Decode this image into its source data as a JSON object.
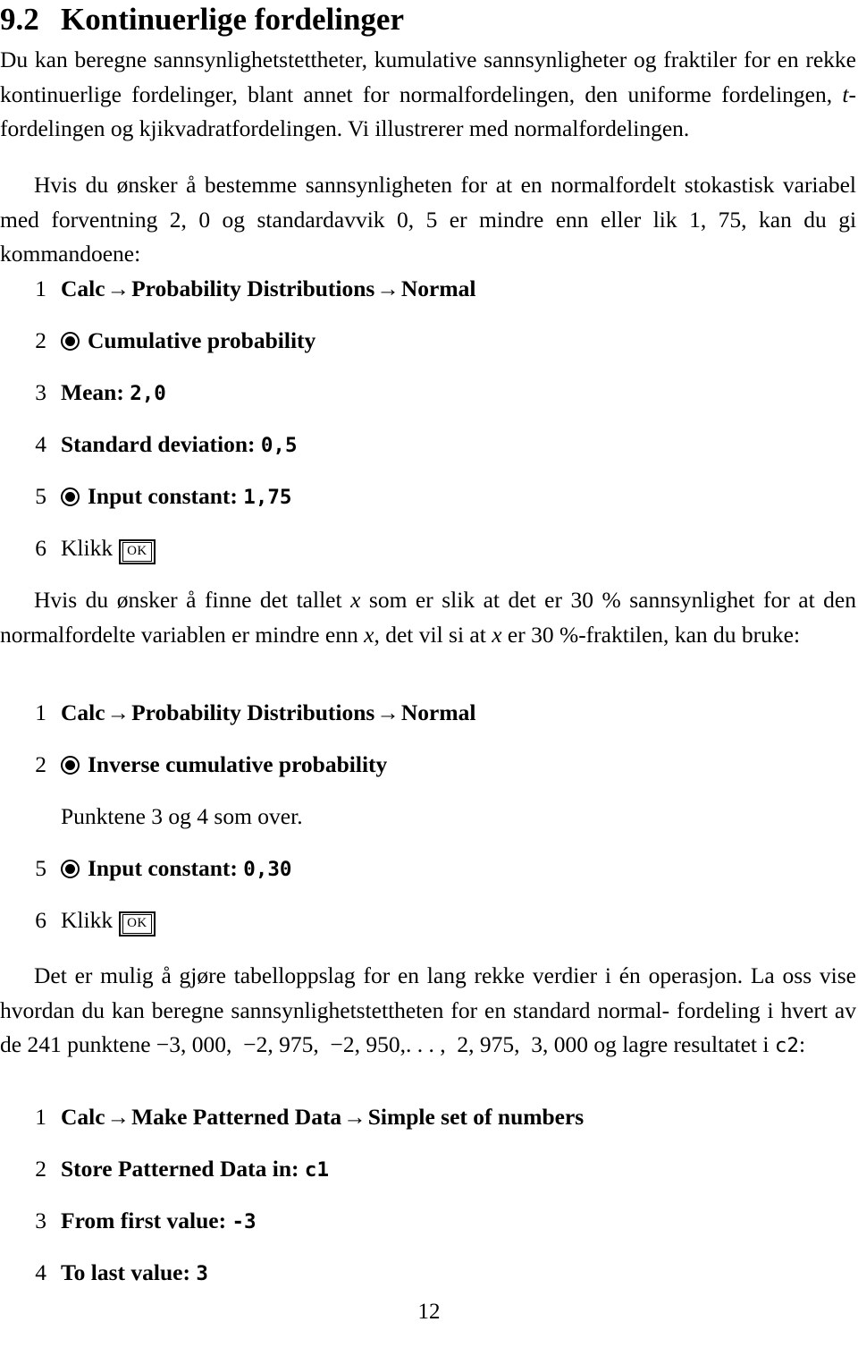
{
  "heading": {
    "number": "9.2",
    "title": "Kontinuerlige fordelinger"
  },
  "paragraph1": {
    "line_a": "Du kan beregne sannsynlighetstettheter, kumulative sannsynligheter og fraktiler",
    "line_b": "for en rekke kontinuerlige fordelinger, blant annet for normalfordelingen, den",
    "line_c_pre": "uniforme fordelingen, ",
    "line_c_math": "t",
    "line_c_post": "-fordelingen og kjikvadratfordelingen. Vi illustrerer med",
    "line_d": "normalfordelingen."
  },
  "paragraph2": {
    "line_a": "Hvis du ønsker å bestemme sannsynligheten for at en normalfordelt stokastisk",
    "line_b_pre": "variabel med forventning ",
    "line_b_val1": "2, 0",
    "line_b_mid": " og standardavvik ",
    "line_b_val2": "0, 5",
    "line_b_post": " er mindre enn eller lik ",
    "line_b_val3": "1, 75",
    "line_b_end": ",",
    "line_c": "kan du gi kommandoene:"
  },
  "list1": [
    {
      "num": "1",
      "type": "menu",
      "parts": [
        "Calc",
        "Probability Distributions",
        "Normal"
      ],
      "arrow": "→"
    },
    {
      "num": "2",
      "type": "radio",
      "label": "Cumulative probability",
      "value": ""
    },
    {
      "num": "3",
      "type": "field",
      "label": "Mean:",
      "value": "2,0"
    },
    {
      "num": "4",
      "type": "field",
      "label": "Standard deviation:",
      "value": "0,5"
    },
    {
      "num": "5",
      "type": "radio",
      "label": "Input constant:",
      "value": "1,75"
    },
    {
      "num": "6",
      "type": "click",
      "label": "Klikk",
      "button": "OK"
    }
  ],
  "paragraph3": {
    "line_a_pre": "Hvis du ønsker å finne det tallet ",
    "line_a_math": "x",
    "line_a_post": " som er slik at det er 30 % sannsynlighet for",
    "line_b_pre": "at den normalfordelte variablen er mindre enn ",
    "line_b_math1": "x",
    "line_b_mid": ", det vil si at ",
    "line_b_math2": "x",
    "line_b_post": " er 30 %-fraktilen,",
    "line_c": "kan du bruke:"
  },
  "list2": [
    {
      "num": "1",
      "type": "menu",
      "parts": [
        "Calc",
        "Probability Distributions",
        "Normal"
      ],
      "arrow": "→"
    },
    {
      "num": "2",
      "type": "radio",
      "label": "Inverse cumulative probability",
      "value": ""
    },
    {
      "num": "",
      "type": "note",
      "label": "Punktene 3 og 4 som over."
    },
    {
      "num": "5",
      "type": "radio",
      "label": "Input constant:",
      "value": "0,30"
    },
    {
      "num": "6",
      "type": "click",
      "label": "Klikk",
      "button": "OK"
    }
  ],
  "paragraph4": {
    "line_a": "Det er mulig å gjøre tabelloppslag for en lang rekke verdier i én operasjon. La",
    "line_b": "oss vise hvordan du kan beregne sannsynlighetstettheten for en standard normal-",
    "line_c_pre": "fordeling i hvert av de 241 punktene ",
    "line_c_v1": "−3, 000,",
    "line_c_v2": "−2, 975,",
    "line_c_v3": "−2, 950,",
    "line_c_dots": ". . . ,",
    "line_c_v4": "2, 975,",
    "line_c_v5": "3, 000",
    "line_d_pre": "og lagre resultatet i ",
    "line_d_mono": "c2",
    "line_d_post": ":"
  },
  "list3": [
    {
      "num": "1",
      "type": "menu",
      "parts": [
        "Calc",
        "Make Patterned Data",
        "Simple set of numbers"
      ],
      "arrow": "→"
    },
    {
      "num": "2",
      "type": "field",
      "label": "Store Patterned Data in:",
      "value": "c1"
    },
    {
      "num": "3",
      "type": "field",
      "label": "From first value:",
      "value": "-3"
    },
    {
      "num": "4",
      "type": "field",
      "label": "To last value:",
      "value": "3"
    }
  ],
  "footer": {
    "page_number": "12"
  }
}
